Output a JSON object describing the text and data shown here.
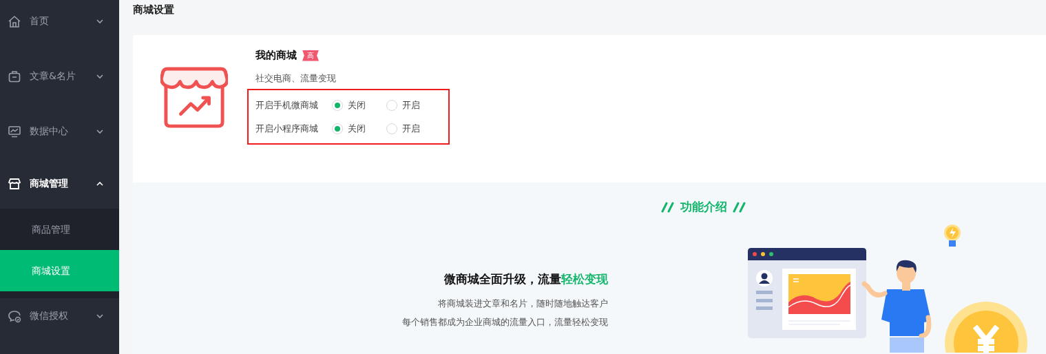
{
  "sidebar": {
    "items": [
      {
        "label": "首页",
        "kind": "home",
        "expanded": false
      },
      {
        "label": "文章&名片",
        "kind": "briefcase",
        "expanded": false
      },
      {
        "label": "数据中心",
        "kind": "monitor",
        "expanded": false
      },
      {
        "label": "商城管理",
        "kind": "store",
        "expanded": true,
        "children": [
          {
            "label": "商品管理",
            "selected": false
          },
          {
            "label": "商城设置",
            "selected": true
          }
        ]
      },
      {
        "label": "微信授权",
        "kind": "chat",
        "expanded": false
      }
    ]
  },
  "page_title": "商城设置",
  "shop_card": {
    "title": "我的商城",
    "badge": "高",
    "subtitle": "社交电商、流量变现",
    "settings": [
      {
        "label": "开启手机微商城",
        "options": [
          {
            "label": "关闭",
            "selected": true
          },
          {
            "label": "开启",
            "selected": false
          }
        ]
      },
      {
        "label": "开启小程序商城",
        "options": [
          {
            "label": "关闭",
            "selected": true
          },
          {
            "label": "开启",
            "selected": false
          }
        ]
      }
    ]
  },
  "feature_intro": {
    "heading": "功能介绍",
    "headline_lead": "微商城全面升级，流量",
    "headline_highlight": "轻松变现",
    "lines": [
      "将商城装进文章和名片，随时随地触达客户",
      "每个销售都成为企业商城的流量入口，流量轻松变现"
    ]
  }
}
